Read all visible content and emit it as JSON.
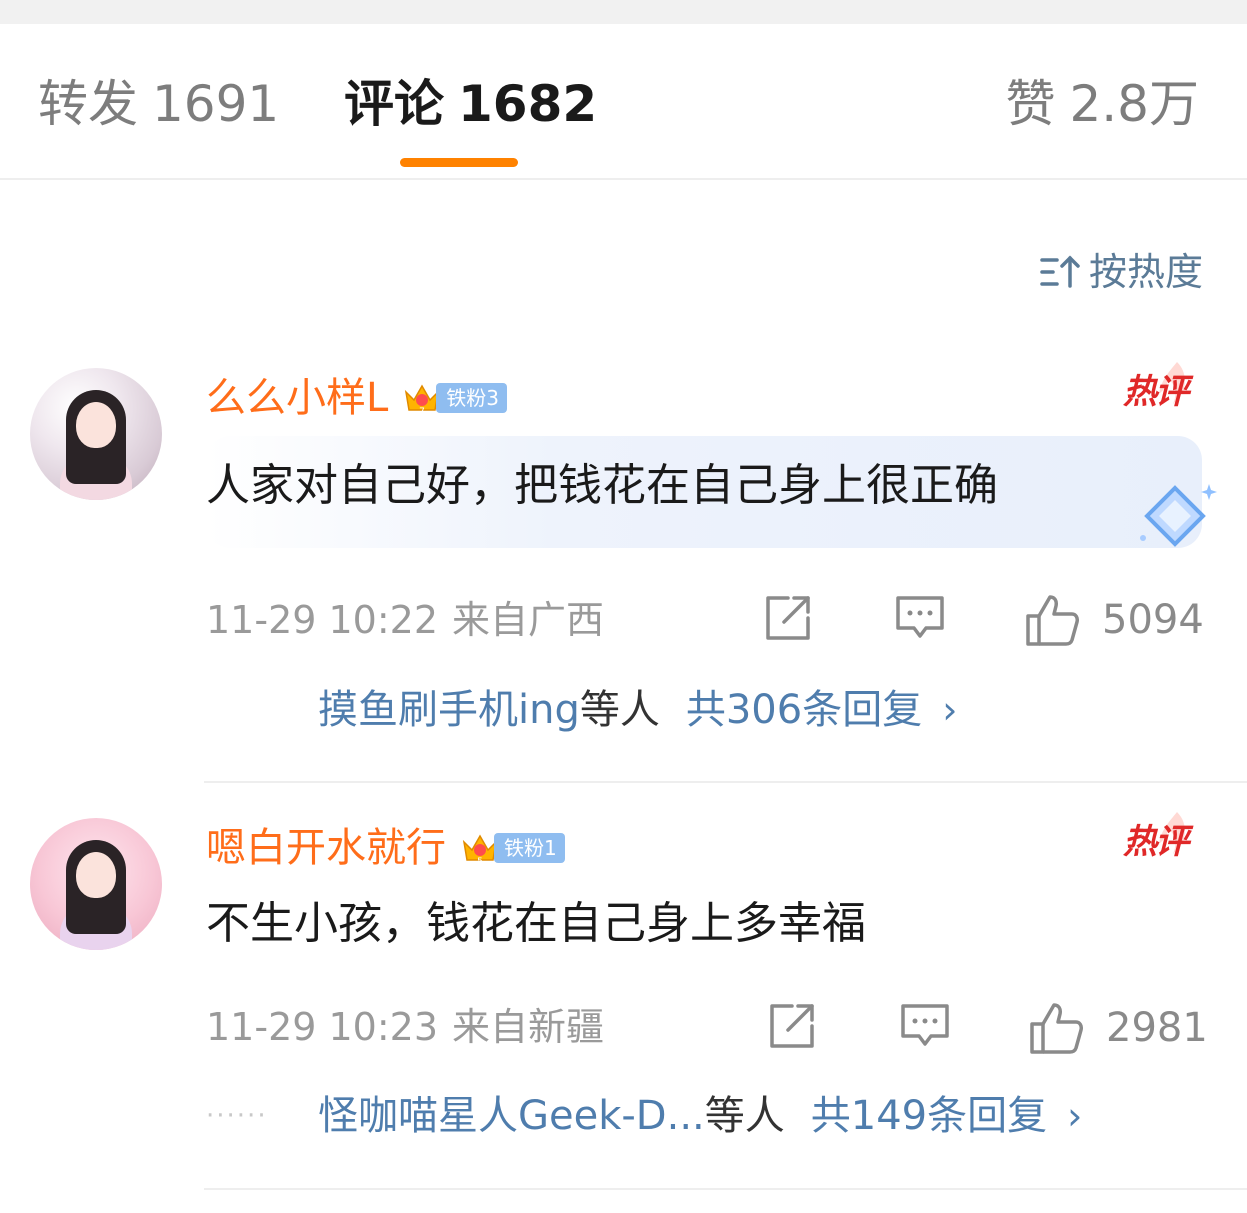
{
  "tabs": {
    "repost": {
      "label": "转发",
      "count": "1691"
    },
    "comment": {
      "label": "评论",
      "count": "1682"
    },
    "like": {
      "label": "赞",
      "count": "2.8万"
    },
    "accent_color": "#ff8200"
  },
  "sort": {
    "label": "按热度",
    "icon": "sort-icon"
  },
  "comments": [
    {
      "username": "么么小样L",
      "fan_badge": "铁粉3",
      "hot_label": "热评",
      "text": "人家对自己好，把钱花在自己身上很正确",
      "time": "11-29 10:22",
      "location": "来自广西",
      "likes": "5094",
      "reply_users": "摸鱼刷手机ing",
      "reply_users_suffix": "等人",
      "reply_count": "共306条回复",
      "reply_arrow": "›"
    },
    {
      "username": "嗯白开水就行",
      "fan_badge": "铁粉1",
      "hot_label": "热评",
      "text": "不生小孩，钱花在自己身上多幸福",
      "time": "11-29 10:23",
      "location": "来自新疆",
      "likes": "2981",
      "reply_dots": "······",
      "reply_users": "怪咖喵星人Geek-D...",
      "reply_users_suffix": "等人",
      "reply_count": "共149条回复",
      "reply_arrow": "›"
    }
  ],
  "colors": {
    "username": "#ff6d1a",
    "link": "#4f7dad",
    "hot": "#e02828",
    "fan_badge": "#8fbdf0"
  }
}
